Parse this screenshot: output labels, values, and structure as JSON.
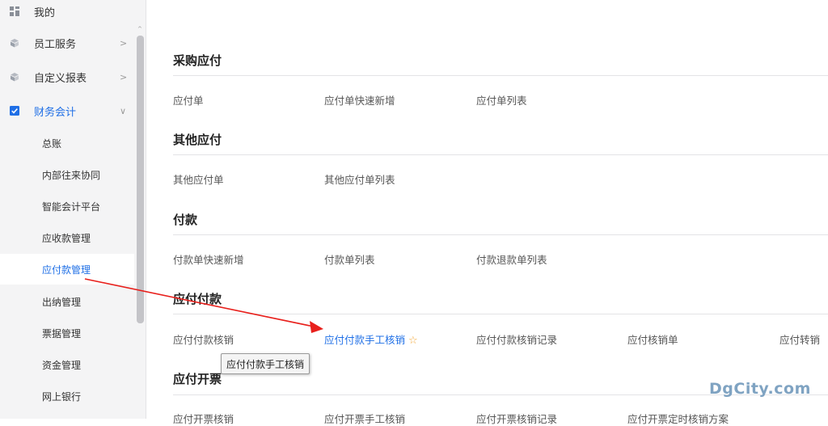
{
  "sidebar": {
    "top_items": [
      {
        "label": "我的",
        "icon": "grid-icon"
      },
      {
        "label": "员工服务",
        "icon": "cube-icon",
        "chevron": ">"
      },
      {
        "label": "自定义报表",
        "icon": "cube-icon",
        "chevron": ">"
      },
      {
        "label": "财务会计",
        "icon": "check-square-icon",
        "chevron": "∨"
      }
    ],
    "sub_items": [
      {
        "label": "总账"
      },
      {
        "label": "内部往来协同"
      },
      {
        "label": "智能会计平台"
      },
      {
        "label": "应收款管理"
      },
      {
        "label": "应付款管理"
      },
      {
        "label": "出纳管理"
      },
      {
        "label": "票据管理"
      },
      {
        "label": "资金管理"
      },
      {
        "label": "网上银行"
      }
    ],
    "scroll_up_glyph": "^"
  },
  "content": {
    "sections": [
      {
        "title": "采购应付",
        "links": [
          "应付单",
          "应付单快速新增",
          "应付单列表"
        ]
      },
      {
        "title": "其他应付",
        "links": [
          "其他应付单",
          "其他应付单列表"
        ]
      },
      {
        "title": "付款",
        "links": [
          "付款单快速新增",
          "付款单列表",
          "付款退款单列表"
        ]
      },
      {
        "title": "应付付款",
        "links": [
          "应付付款核销",
          "应付付款手工核销",
          "应付付款核销记录",
          "应付核销单",
          "应付转销"
        ]
      },
      {
        "title": "应付开票",
        "links": [
          "应付开票核销",
          "应付开票手工核销",
          "应付开票核销记录",
          "应付开票定时核销方案"
        ]
      }
    ],
    "star_glyph": "☆",
    "tooltip": "应付付款手工核销"
  },
  "watermark": "DgCity.com",
  "colors": {
    "accent": "#1f6fe6",
    "arrow": "#e8201c",
    "star": "#f2a93b",
    "sidebar_bg": "#f4f4f5"
  }
}
